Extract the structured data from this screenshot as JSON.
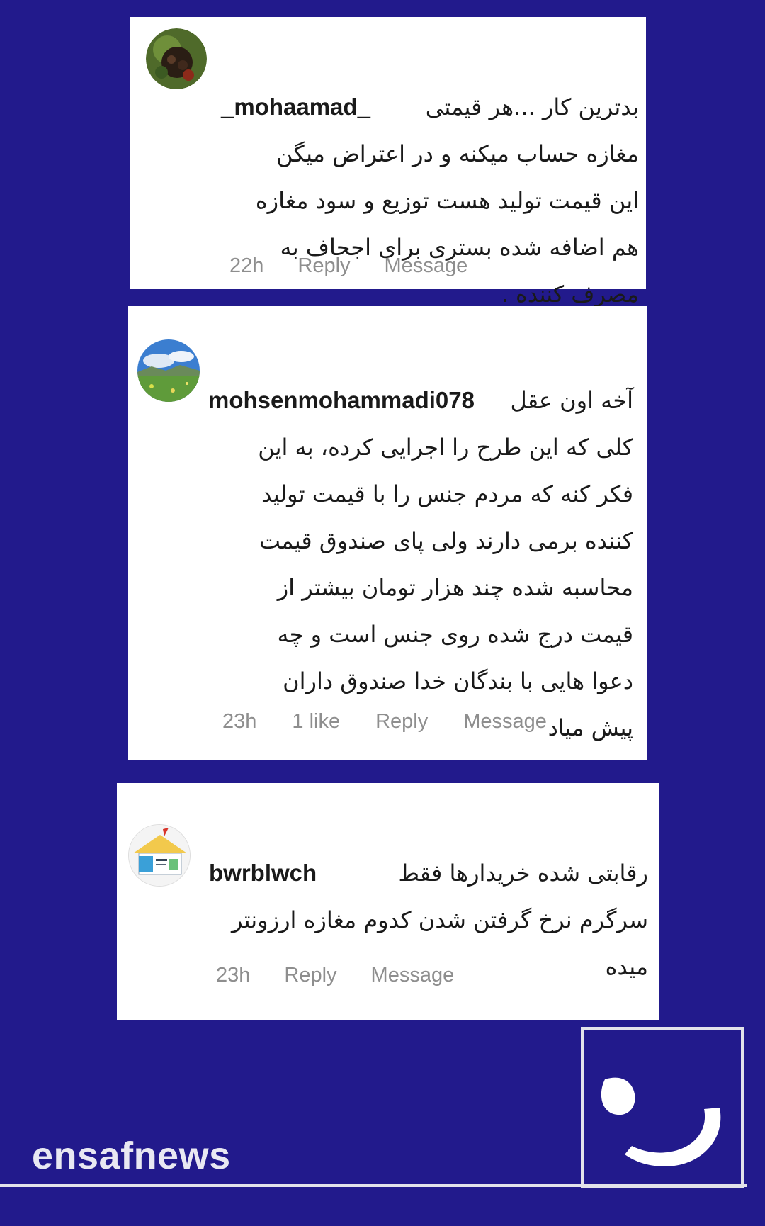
{
  "comments": [
    {
      "username": "_mohaamad_",
      "text": "بدترین کار ...هر قیمتی\nمغازه حساب میکنه و در اعتراض میگن\nاین قیمت تولید هست توزیع و سود مغازه\nهم اضافه شده بستری برای اجحاف به\nمصرف کننده .",
      "time": "22h",
      "likes": "",
      "reply_label": "Reply",
      "message_label": "Message",
      "avatar_icon": "profile-photo-fruit"
    },
    {
      "username": "mohsenmohammadi078",
      "text": "آخه اون عقل\nکلی که این طرح را اجرایی کرده، به این\nفکر کنه که مردم جنس را با قیمت تولید\nکننده برمی دارند ولی پای صندوق قیمت\nمحاسبه شده چند هزار تومان بیشتر از\nقیمت درج شده روی جنس است و چه\nدعوا هایی با بندگان خدا صندوق داران\nپیش میاد",
      "time": "23h",
      "likes": "1 like",
      "reply_label": "Reply",
      "message_label": "Message",
      "avatar_icon": "profile-photo-landscape"
    },
    {
      "username": "bwrblwch",
      "text": "رقابتی شده خریدارها فقط\nسرگرم نرخ گرفتن شدن کدوم مغازه ارزونتر\nمیده",
      "time": "23h",
      "likes": "",
      "reply_label": "Reply",
      "message_label": "Message",
      "avatar_icon": "profile-photo-logo"
    }
  ],
  "watermark": {
    "brand": "ensafnews",
    "logo_icon": "ensaf-logo"
  },
  "colors": {
    "background": "#221a8c",
    "card": "#ffffff",
    "meta_text": "#8e8e8e",
    "watermark": "#e8e8f2"
  }
}
